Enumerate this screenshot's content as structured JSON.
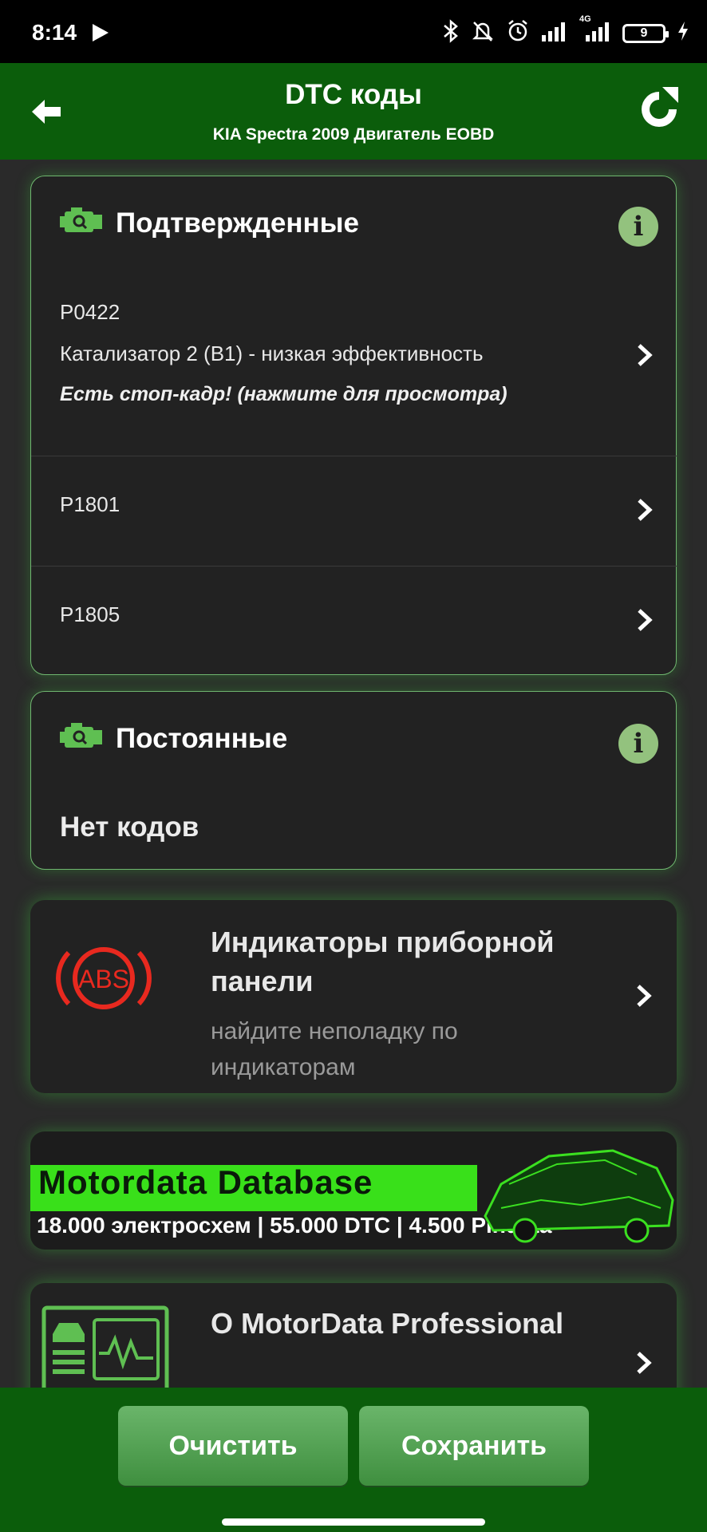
{
  "status_bar": {
    "time": "8:14",
    "network": "4G",
    "battery": "9"
  },
  "app_bar": {
    "title": "DTC коды",
    "subtitle": "KIA Spectra 2009 Двигатель EOBD"
  },
  "confirmed": {
    "label": "Подтвержденные",
    "info_symbol": "i",
    "codes": [
      {
        "code": "P0422",
        "description": "Катализатор 2 (B1) - низкая эффективность",
        "hint": "Есть стоп-кадр! (нажмите для просмотра)"
      },
      {
        "code": "P1801",
        "description": "",
        "hint": ""
      },
      {
        "code": "P1805",
        "description": "",
        "hint": ""
      }
    ]
  },
  "permanent": {
    "label": "Постоянные",
    "info_symbol": "i",
    "empty_text": "Нет кодов"
  },
  "dashboard": {
    "icon_text": "ABS",
    "title": "Индикаторы приборной панели",
    "subtitle": "найдите неполадку по индикаторам"
  },
  "banner": {
    "headline": "Motordata Database",
    "stats": "18.000 электросхем | 55.000 DTC | 4.500 Pindata"
  },
  "about": {
    "title": "О MotorData Professional"
  },
  "bottom_bar": {
    "clear_label": "Очистить",
    "save_label": "Сохранить"
  },
  "colors": {
    "brand_green": "#0b5d0b",
    "accent_green": "#39e01a",
    "icon_green": "#5fbf52",
    "abs_red": "#e8291f"
  }
}
